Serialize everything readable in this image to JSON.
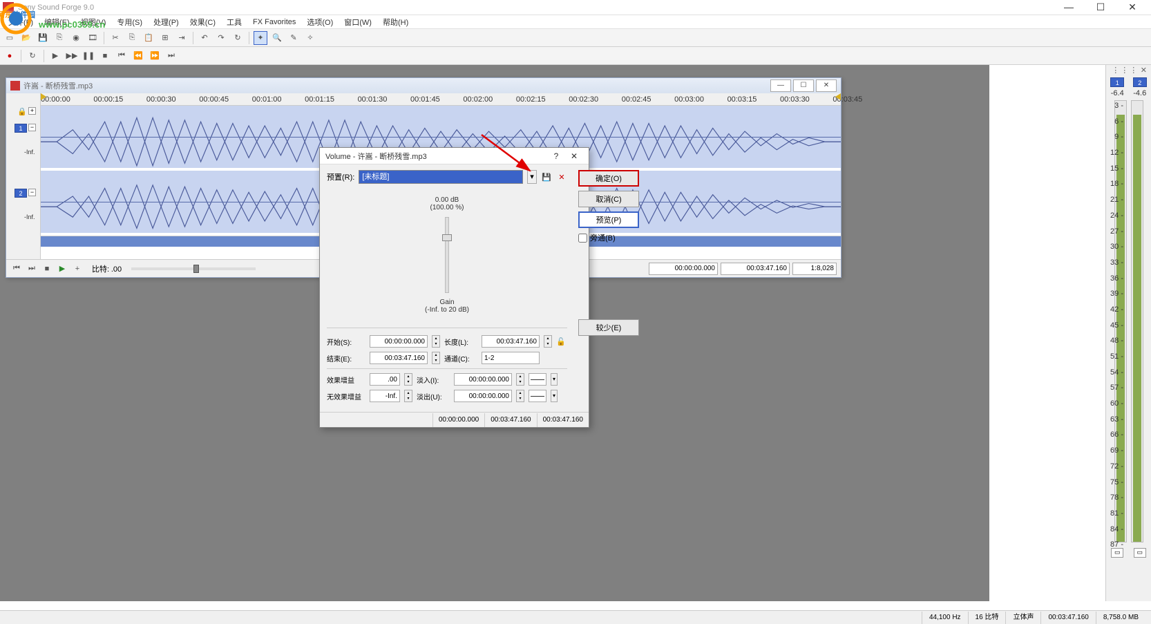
{
  "app": {
    "title": "Sony Sound Forge 9.0"
  },
  "watermark": {
    "line1a": "河东",
    "line1b": "软件园",
    "line2": "www.pc0359.cn"
  },
  "menu": [
    "文件(F)",
    "编辑(E)",
    "视图(V)",
    "专用(S)",
    "处理(P)",
    "效果(C)",
    "工具",
    "FX Favorites",
    "选项(O)",
    "窗口(W)",
    "帮助(H)"
  ],
  "doc": {
    "title": "许嵩 - 断桥残雪.mp3",
    "channels": [
      "1",
      "2"
    ],
    "inf_label": "-Inf.",
    "ruler": [
      "00:00:00",
      "00:00:15",
      "00:00:30",
      "00:00:45",
      "00:01:00",
      "00:01:15",
      "00:01:30",
      "00:01:45",
      "00:02:00",
      "00:02:15",
      "00:02:30",
      "00:02:45",
      "00:03:00",
      "00:03:15",
      "00:03:30",
      "00:03:45"
    ],
    "rate_label": "比特:",
    "rate_value": ".00",
    "time_start": "00:00:00.000",
    "time_end": "00:03:47.160",
    "ratio": "1:8,028"
  },
  "dialog": {
    "title": "Volume - 许嵩 - 断桥残雪.mp3",
    "preset_label": "预置(R):",
    "preset_value": "[未标题]",
    "gain_db": "0.00 dB",
    "gain_pct": "(100.00 %)",
    "gain_caption": "Gain",
    "gain_range": "(-Inf. to 20 dB)",
    "start_label": "开始(S):",
    "start_value": "00:00:00.000",
    "end_label": "结束(E):",
    "end_value": "00:03:47.160",
    "length_label": "长度(L):",
    "length_value": "00:03:47.160",
    "channel_label": "通道(C):",
    "channel_value": "1-2",
    "fxgain_label": "效果增益",
    "fxgain_value": ".00",
    "nofxgain_label": "无效果增益",
    "nofxgain_value": "-Inf.",
    "fadein_label": "淡入(I):",
    "fadein_value": "00:00:00.000",
    "fadeout_label": "淡出(U):",
    "fadeout_value": "00:00:00.000",
    "ok": "确定(O)",
    "cancel": "取消(C)",
    "preview": "预览(P)",
    "bypass": "旁通(B)",
    "less": "较少(E)",
    "status": [
      "00:00:00.000",
      "00:03:47.160",
      "00:03:47.160"
    ]
  },
  "meters": {
    "ch": [
      "1",
      "2"
    ],
    "peak": [
      "-6.4",
      "-4.6"
    ],
    "scale": [
      "3",
      "6",
      "9",
      "12",
      "15",
      "18",
      "21",
      "24",
      "27",
      "30",
      "33",
      "36",
      "39",
      "42",
      "45",
      "48",
      "51",
      "54",
      "57",
      "60",
      "63",
      "66",
      "69",
      "72",
      "75",
      "78",
      "81",
      "84",
      "87"
    ]
  },
  "status": {
    "rate": "44,100 Hz",
    "bits": "16 比特",
    "mode": "立体声",
    "len": "00:03:47.160",
    "mem": "8,758.0 MB"
  }
}
